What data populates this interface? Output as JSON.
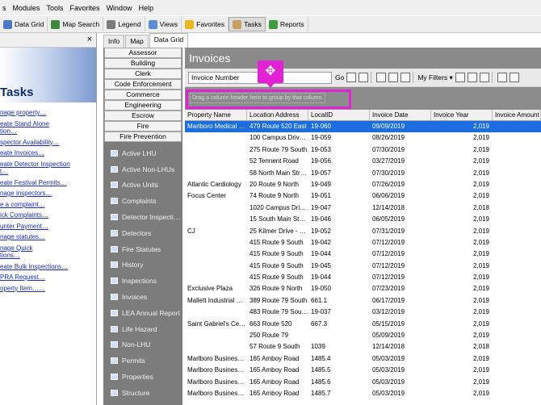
{
  "menu": [
    "s",
    "Modules",
    "Tools",
    "Favorites",
    "Window",
    "Help"
  ],
  "toolbar": [
    {
      "label": "Data Grid",
      "icon": "grid-icon",
      "color": "#4a78c8"
    },
    {
      "label": "Map Search",
      "icon": "globe-icon",
      "color": "#3b8b3b"
    },
    {
      "label": "Legend",
      "icon": "legend-icon",
      "color": "#7a7a7a"
    },
    {
      "label": "Views",
      "icon": "views-icon",
      "color": "#5a8cd8"
    },
    {
      "label": "Favorites",
      "icon": "star-icon",
      "color": "#e8b820"
    },
    {
      "label": "Tasks",
      "icon": "tasks-icon",
      "color": "#c8a060"
    },
    {
      "label": "Reports",
      "icon": "reports-icon",
      "color": "#3e9b3e"
    }
  ],
  "tasks": {
    "close": "×",
    "title": "Tasks",
    "links": [
      "nage property…",
      "eate Stand Alone",
      "tion…",
      "spector Availability…",
      "eate Invoices…",
      "eate Detector Inspection",
      "t…",
      "eate Festival Permits…",
      "nage inspectors…",
      "e a complaint…",
      "ick Complaints…",
      "unter Payment…",
      "nage statutes…",
      "nage Quick",
      "tions…",
      "eate Bulk Inspections…",
      "PRA Request…",
      "operty Item……"
    ]
  },
  "tabs": [
    "Info",
    "Map",
    "Data Grid"
  ],
  "nav": {
    "buttons": [
      "Assessor",
      "Building",
      "Clerk",
      "Code Enforcement",
      "Commerce",
      "Engineering",
      "Escrow",
      "Fire",
      "Fire Prevention"
    ],
    "items": [
      "Active LHU",
      "Active Non-LHUs",
      "Active Units",
      "Complaints",
      "Detector Inspecti…",
      "Detectors",
      "Fire Statutes",
      "History",
      "Inspections",
      "Invoices",
      "LEA Annual Report",
      "Life Hazard",
      "Non-LHU",
      "Permits",
      "Properties",
      "Structure"
    ]
  },
  "main": {
    "title": "Invoices",
    "search_value": "Invoice Number",
    "go": "Go",
    "my_filters": "My Filters ▾",
    "drop_hint": "Drag a column header here to group by that column."
  },
  "grid": {
    "columns": [
      "Property Name",
      "Location Address",
      "LocalID",
      "Invoice Date",
      "Invoice Year",
      "Invoice Amount"
    ],
    "rows": [
      [
        "Marlboro Medical …",
        "479 Route 520 East",
        "19-060",
        "09/09/2019",
        "2,019",
        ""
      ],
      [
        "",
        "100 Campus Driv…",
        "19-059",
        "08/26/2019",
        "2,019",
        ""
      ],
      [
        "",
        "275 Route 79 South",
        "19-053",
        "07/30/2019",
        "2,019",
        ""
      ],
      [
        "",
        "52 Tennent Road",
        "19-056",
        "03/27/2019",
        "2,019",
        ""
      ],
      [
        "",
        "58 North Main Str…",
        "19-057",
        "07/30/2019",
        "2,019",
        ""
      ],
      [
        "Atlantic Cardiology",
        "20 Route 9 North",
        "19-049",
        "07/26/2019",
        "2,019",
        ""
      ],
      [
        "Focus Center",
        "74 Route 9 North",
        "19-051",
        "06/06/2019",
        "2,019",
        ""
      ],
      [
        "",
        "1020 Campus Dri…",
        "19-047",
        "12/14/2018",
        "2,018",
        ""
      ],
      [
        "",
        "15 South Main St…",
        "19-046",
        "06/05/2019",
        "2,019",
        ""
      ],
      [
        "CJ",
        "25 Kilmer Drive - …",
        "19-052",
        "07/31/2019",
        "2,019",
        ""
      ],
      [
        "",
        "415 Route 9 South",
        "19-042",
        "07/12/2019",
        "2,019",
        ""
      ],
      [
        "",
        "415 Route 9 South",
        "19-044",
        "07/12/2019",
        "2,019",
        ""
      ],
      [
        "",
        "415 Route 9 South",
        "19-045",
        "07/12/2019",
        "2,019",
        ""
      ],
      [
        "",
        "415 Route 9 South",
        "19-044",
        "07/12/2019",
        "2,019",
        ""
      ],
      [
        "Exclusive Plaza",
        "326 Route 9 North",
        "19-050",
        "07/23/2019",
        "2,019",
        ""
      ],
      [
        "Mallett Industrial …",
        "389 Route 79 South",
        "661.1",
        "06/17/2019",
        "2,019",
        ""
      ],
      [
        "",
        "483 Route 79 Sou…",
        "19-037",
        "03/12/2019",
        "2,019",
        ""
      ],
      [
        "Saint Gabriel's Ce…",
        "663 Route 520",
        "667.3",
        "05/15/2019",
        "2,019",
        ""
      ],
      [
        "",
        "250 Route 79",
        "",
        "05/09/2019",
        "2,019",
        ""
      ],
      [
        "",
        "57 Route 9 South",
        "1039",
        "12/14/2018",
        "2,018",
        ""
      ],
      [
        "Marlboro Busines…",
        "165 Amboy Road",
        "1485.4",
        "05/03/2019",
        "2,019",
        ""
      ],
      [
        "Marlboro Busines…",
        "165 Amboy Road",
        "1485.5",
        "05/03/2019",
        "2,019",
        ""
      ],
      [
        "Marlboro Busines…",
        "165 Amboy Road",
        "1485.6",
        "05/03/2019",
        "2,019",
        ""
      ],
      [
        "Marlboro Busines…",
        "165 Amboy Road",
        "1485.7",
        "05/03/2019",
        "2,019",
        ""
      ]
    ]
  },
  "highlight_color": "#e321d4"
}
